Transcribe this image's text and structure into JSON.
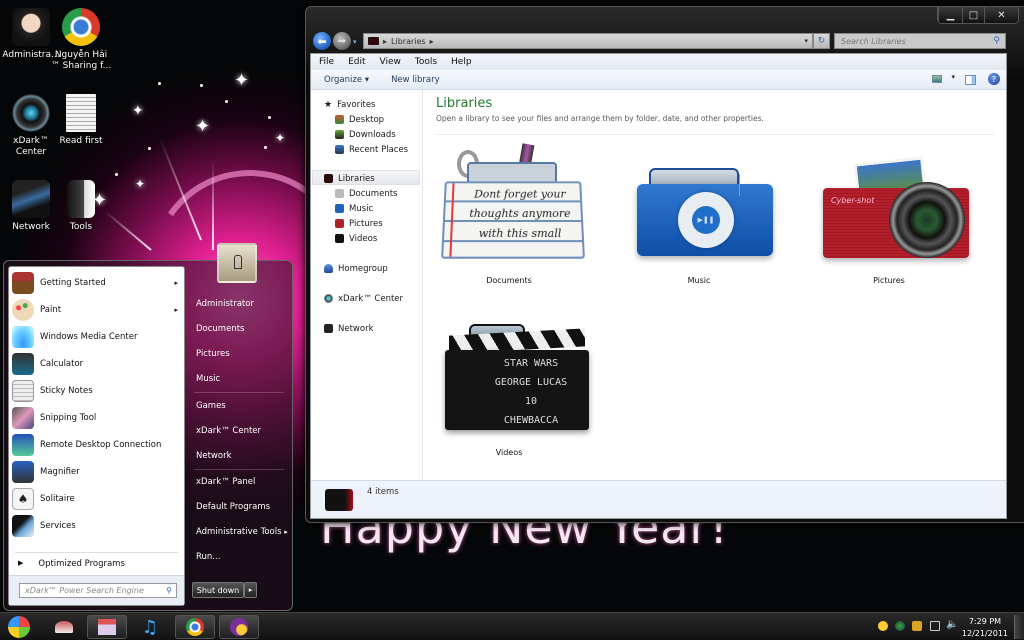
{
  "desktop": {
    "icons": [
      {
        "label": "Administra...",
        "icon": "user-avatar-icon"
      },
      {
        "label": "Nguyễn Hải ™ Sharing f...",
        "icon": "chrome-icon"
      },
      {
        "label": "xDark™ Center",
        "icon": "xdark-center-icon"
      },
      {
        "label": "Read first",
        "icon": "document-icon"
      },
      {
        "label": "Network",
        "icon": "network-icon"
      },
      {
        "label": "Tools",
        "icon": "folder-icon"
      }
    ],
    "wallpaper_text": "Happy New Year!"
  },
  "explorer": {
    "address": {
      "root_label": "Libraries"
    },
    "search_placeholder": "Search Libraries",
    "caption_buttons": {
      "minimize": "▁",
      "maximize": "□",
      "close": "✕"
    },
    "menu": [
      "File",
      "Edit",
      "View",
      "Tools",
      "Help"
    ],
    "commands": {
      "organize": "Organize ▾",
      "new_library": "New library"
    },
    "nav": {
      "favorites": {
        "label": "Favorites",
        "items": [
          "Desktop",
          "Downloads",
          "Recent Places"
        ]
      },
      "libraries": {
        "label": "Libraries",
        "items": [
          "Documents",
          "Music",
          "Pictures",
          "Videos"
        ]
      },
      "homegroup": "Homegroup",
      "xdark": "xDark™ Center",
      "network": "Network"
    },
    "content": {
      "title": "Libraries",
      "description": "Open a library to see your files and arrange them by folder, date, and other properties.",
      "libraries": [
        {
          "label": "Documents",
          "art_lines": [
            "Dont forget your",
            "thoughts anymore",
            "with this small"
          ]
        },
        {
          "label": "Music"
        },
        {
          "label": "Pictures",
          "art_text": "Cyber-shot"
        },
        {
          "label": "Videos",
          "art_lines": [
            "STAR WARS",
            "GEORGE LUCAS",
            "10",
            "CHEWBACCA"
          ]
        }
      ]
    },
    "status": {
      "count": "4 items"
    }
  },
  "start_menu": {
    "programs": [
      {
        "label": "Getting Started",
        "submenu": true
      },
      {
        "label": "Paint",
        "submenu": true
      },
      {
        "label": "Windows Media Center",
        "submenu": false
      },
      {
        "label": "Calculator",
        "submenu": false
      },
      {
        "label": "Sticky Notes",
        "submenu": false
      },
      {
        "label": "Snipping Tool",
        "submenu": false
      },
      {
        "label": "Remote Desktop Connection",
        "submenu": false
      },
      {
        "label": "Magnifier",
        "submenu": false
      },
      {
        "label": "Solitaire",
        "submenu": false
      },
      {
        "label": "Services",
        "submenu": false
      }
    ],
    "all_programs": "Optimized Programs",
    "search_placeholder": "xDark™ Power Search Engine",
    "right_items": [
      "Administrator",
      "Documents",
      "Pictures",
      "Music",
      "Games",
      "xDark™ Center",
      "Network",
      "xDark™ Panel",
      "Default Programs",
      "Administrative Tools",
      "Run..."
    ],
    "shutdown": "Shut down",
    "arrow": "▸"
  },
  "taskbar": {
    "clock": {
      "time": "7:29 PM",
      "date": "12/21/2011"
    }
  }
}
